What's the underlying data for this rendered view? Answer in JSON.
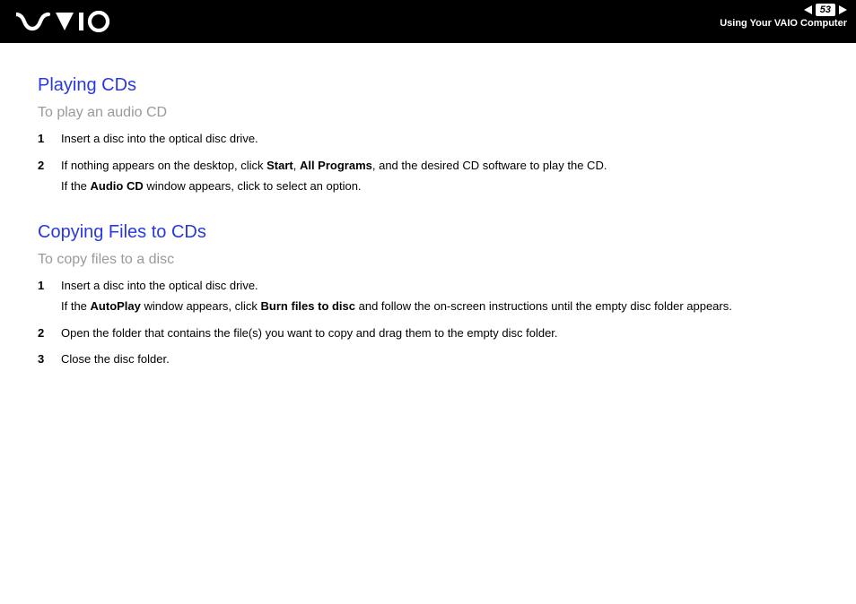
{
  "header": {
    "page_number": "53",
    "breadcrumb": "Using Your VAIO Computer"
  },
  "section1": {
    "title": "Playing CDs",
    "subtitle": "To play an audio CD",
    "steps": {
      "n1": "1",
      "t1": "Insert a disc into the optical disc drive.",
      "n2": "2",
      "t2a_pre": "If nothing appears on the desktop, click ",
      "t2a_b1": "Start",
      "t2a_mid1": ", ",
      "t2a_b2": "All Programs",
      "t2a_post": ", and the desired CD software to play the CD.",
      "t2b_pre": "If the ",
      "t2b_b": "Audio CD",
      "t2b_post": " window appears, click to select an option."
    }
  },
  "section2": {
    "title": "Copying Files to CDs",
    "subtitle": "To copy files to a disc",
    "steps": {
      "n1": "1",
      "t1a": "Insert a disc into the optical disc drive.",
      "t1b_pre": "If the ",
      "t1b_b1": "AutoPlay",
      "t1b_mid": " window appears, click ",
      "t1b_b2": "Burn files to disc",
      "t1b_post": " and follow the on-screen instructions until the empty disc folder appears.",
      "n2": "2",
      "t2": "Open the folder that contains the file(s) you want to copy and drag them to the empty disc folder.",
      "n3": "3",
      "t3": "Close the disc folder."
    }
  }
}
